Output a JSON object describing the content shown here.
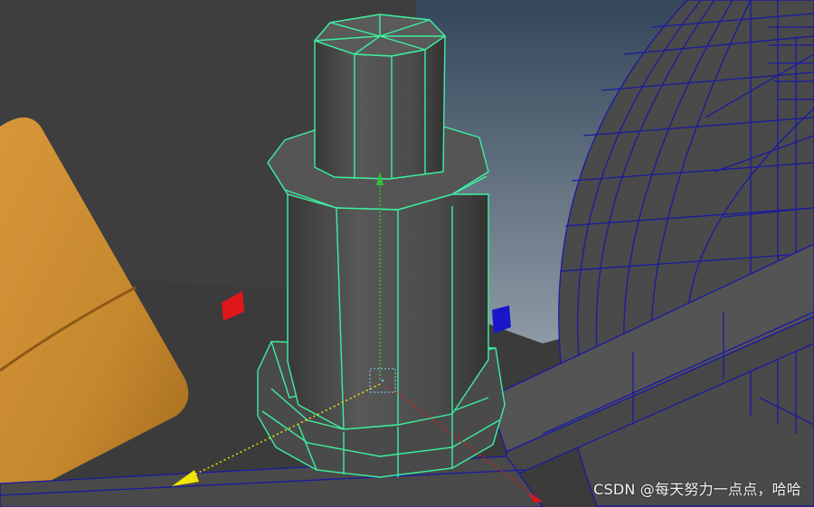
{
  "watermark": {
    "text": "CSDN @每天努力一点点，哈哈"
  },
  "colors": {
    "viewport_background": "#3b3b3b",
    "backdrop_gradient_top": "#34465a",
    "backdrop_gradient_bottom": "#8e9aa5",
    "selection_wireframe": "#3cf0a0",
    "unselected_wireframe": "#1a1aa0",
    "mesh_body": "#4d4d4d",
    "cushion": "#c5882e",
    "axis_x": "#e0161b",
    "axis_y": "#31c13a",
    "axis_z": "#1717c9",
    "axis_yellow": "#f0e400",
    "pivot": "#7db8d6"
  },
  "icons": {
    "manipulator": "move-manipulator-icon",
    "pivot": "pivot-square-icon"
  }
}
